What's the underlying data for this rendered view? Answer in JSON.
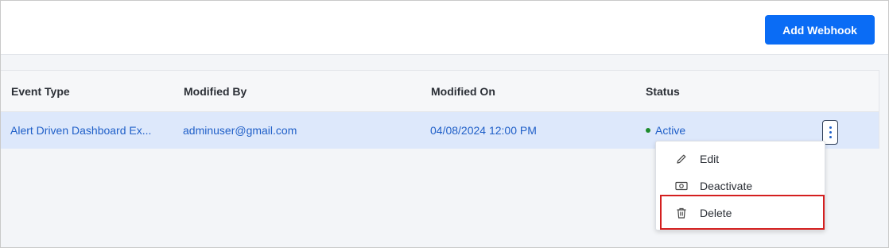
{
  "toolbar": {
    "add_button_label": "Add Webhook"
  },
  "grid": {
    "columns": [
      "Event Type",
      "Modified By",
      "Modified On",
      "Status"
    ],
    "rows": [
      {
        "event_type": "Alert Driven Dashboard Ex...",
        "modified_by": "adminuser@gmail.com",
        "modified_on": "04/08/2024 12:00 PM",
        "status": "Active"
      }
    ]
  },
  "context_menu": {
    "items": [
      {
        "label": "Edit",
        "icon": "pencil-icon"
      },
      {
        "label": "Deactivate",
        "icon": "deactivate-icon"
      },
      {
        "label": "Delete",
        "icon": "trash-icon"
      }
    ]
  },
  "colors": {
    "accent": "#0a6cf5",
    "row_selected": "#dde8fb",
    "link_text": "#1f5fc8",
    "status_active": "#1e8c2d",
    "highlight": "#d41f1f"
  }
}
